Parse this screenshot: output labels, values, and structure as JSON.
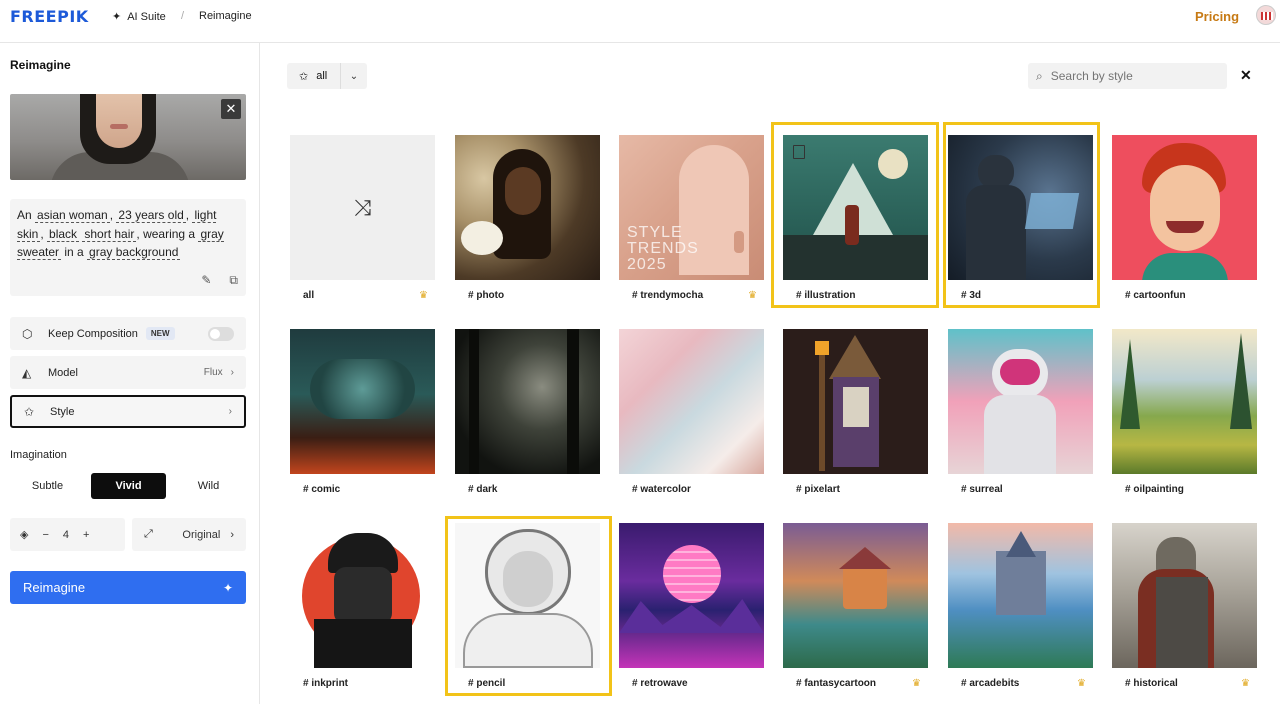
{
  "header": {
    "logo": "FREEPIK",
    "ai_suite": "AI Suite",
    "separator": "/",
    "page": "Reimagine",
    "pricing": "Pricing"
  },
  "sidebar": {
    "title": "Reimagine",
    "close_icon": "close-icon",
    "prompt_segments": [
      "An ",
      "asian woman",
      ", ",
      "23 years old",
      ", ",
      "light skin",
      ", ",
      "black",
      " ",
      "short hair",
      ", wearing a ",
      "gray sweater",
      " in a ",
      "gray background"
    ],
    "keep_composition": {
      "label": "Keep Composition",
      "badge": "NEW",
      "enabled": false
    },
    "model": {
      "label": "Model",
      "value": "Flux"
    },
    "style": {
      "label": "Style"
    },
    "imagination": {
      "title": "Imagination",
      "options": [
        "Subtle",
        "Vivid",
        "Wild"
      ],
      "selected": "Vivid"
    },
    "count": {
      "minus": "−",
      "value": "4",
      "plus": "+"
    },
    "ratio": {
      "label": "Original"
    },
    "cta": "Reimagine"
  },
  "main": {
    "filter": {
      "label": "all"
    },
    "search": {
      "placeholder": "Search by style"
    },
    "tiles": [
      {
        "label": "all",
        "premium": true,
        "highlighted": false
      },
      {
        "label": "# photo",
        "premium": false,
        "highlighted": false
      },
      {
        "label": "# trendymocha",
        "premium": true,
        "highlighted": false,
        "overlay": "STYLE TRENDS 2025"
      },
      {
        "label": "# illustration",
        "premium": false,
        "highlighted": true
      },
      {
        "label": "# 3d",
        "premium": false,
        "highlighted": true
      },
      {
        "label": "# cartoonfun",
        "premium": false,
        "highlighted": false
      },
      {
        "label": "# comic",
        "premium": false,
        "highlighted": false
      },
      {
        "label": "# dark",
        "premium": false,
        "highlighted": false
      },
      {
        "label": "# watercolor",
        "premium": false,
        "highlighted": false
      },
      {
        "label": "# pixelart",
        "premium": false,
        "highlighted": false
      },
      {
        "label": "# surreal",
        "premium": false,
        "highlighted": false
      },
      {
        "label": "# oilpainting",
        "premium": false,
        "highlighted": false
      },
      {
        "label": "# inkprint",
        "premium": false,
        "highlighted": false
      },
      {
        "label": "# pencil",
        "premium": false,
        "highlighted": true
      },
      {
        "label": "# retrowave",
        "premium": false,
        "highlighted": false
      },
      {
        "label": "# fantasycartoon",
        "premium": true,
        "highlighted": false
      },
      {
        "label": "# arcadebits",
        "premium": true,
        "highlighted": false
      },
      {
        "label": "# historical",
        "premium": true,
        "highlighted": false
      }
    ]
  },
  "colors": {
    "brand": "#1d5ad8",
    "pricing": "#c77a14",
    "cta": "#2f6ef0",
    "highlight": "#f2c318",
    "crown": "#e1a81e"
  }
}
